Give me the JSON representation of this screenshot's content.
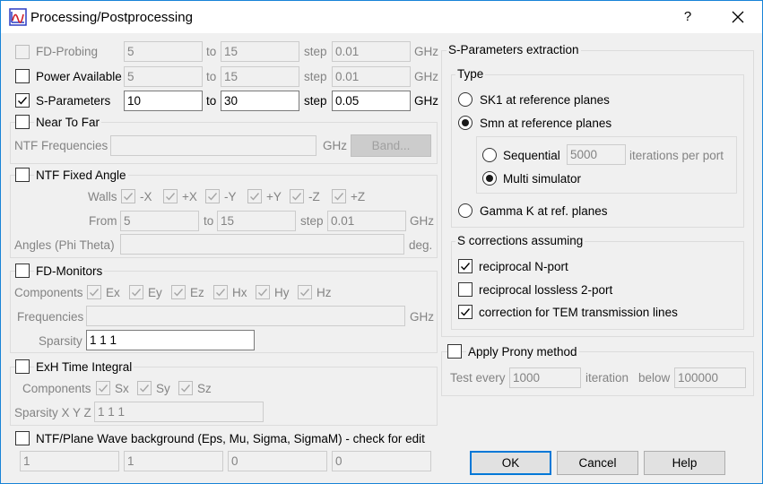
{
  "window": {
    "title": "Processing/Postprocessing",
    "help": "?",
    "close": "✕"
  },
  "left": {
    "fd_probing": {
      "label": "FD-Probing",
      "from": "5",
      "to_label": "to",
      "to": "15",
      "step_label": "step",
      "step": "0.01",
      "unit": "GHz"
    },
    "power_available": {
      "label": "Power Available",
      "from": "5",
      "to_label": "to",
      "to": "15",
      "step_label": "step",
      "step": "0.01",
      "unit": "GHz"
    },
    "s_parameters": {
      "label": "S-Parameters",
      "from": "10",
      "to_label": "to",
      "to": "30",
      "step_label": "step",
      "step": "0.05",
      "unit": "GHz"
    },
    "near_to_far": {
      "label": "Near To Far",
      "ntf_freq_label": "NTF Frequencies",
      "ntf_freq_value": "",
      "unit": "GHz",
      "band_button": "Band..."
    },
    "ntf_fixed_angle": {
      "label": "NTF Fixed Angle",
      "walls_label": "Walls",
      "walls": [
        "-X",
        "+X",
        "-Y",
        "+Y",
        "-Z",
        "+Z"
      ],
      "from_label": "From",
      "from": "5",
      "to_label": "to",
      "to": "15",
      "step_label": "step",
      "step": "0.01",
      "unit": "GHz",
      "angles_label": "Angles (Phi Theta)",
      "angles_value": "",
      "angles_unit": "deg."
    },
    "fd_monitors": {
      "label": "FD-Monitors",
      "components_label": "Components",
      "components": [
        "Ex",
        "Ey",
        "Ez",
        "Hx",
        "Hy",
        "Hz"
      ],
      "frequencies_label": "Frequencies",
      "frequencies_value": "",
      "unit": "GHz",
      "sparsity_label": "Sparsity",
      "sparsity_value": "1 1 1"
    },
    "exh_time_integral": {
      "label": "ExH Time Integral",
      "components_label": "Components",
      "components": [
        "Sx",
        "Sy",
        "Sz"
      ],
      "sparsity_label": "Sparsity X Y Z",
      "sparsity_value": "1 1 1"
    },
    "ntf_plane_wave": {
      "label": "NTF/Plane Wave background (Eps, Mu, Sigma, SigmaM) - check for edit",
      "values": [
        "1",
        "1",
        "0",
        "0"
      ]
    }
  },
  "right": {
    "extraction_title": "S-Parameters extraction",
    "type_title": "Type",
    "type_options": {
      "sk1": "SK1 at reference planes",
      "smn": "Smn at reference planes",
      "sequential": "Sequential",
      "sequential_iterations": "5000",
      "iterations_label": "iterations per port",
      "multi": "Multi simulator",
      "gamma": "Gamma K at ref. planes"
    },
    "corrections_title": "S corrections assuming",
    "corrections": [
      {
        "label": "reciprocal N-port",
        "checked": true
      },
      {
        "label": "reciprocal lossless 2-port",
        "checked": false
      },
      {
        "label": "correction for TEM transmission lines",
        "checked": true
      }
    ],
    "prony": {
      "label": "Apply Prony method",
      "test_label": "Test every",
      "test_value": "1000",
      "iteration_label": "iteration",
      "below_label": "below",
      "below_value": "100000"
    }
  },
  "buttons": {
    "ok": "OK",
    "cancel": "Cancel",
    "help": "Help"
  }
}
